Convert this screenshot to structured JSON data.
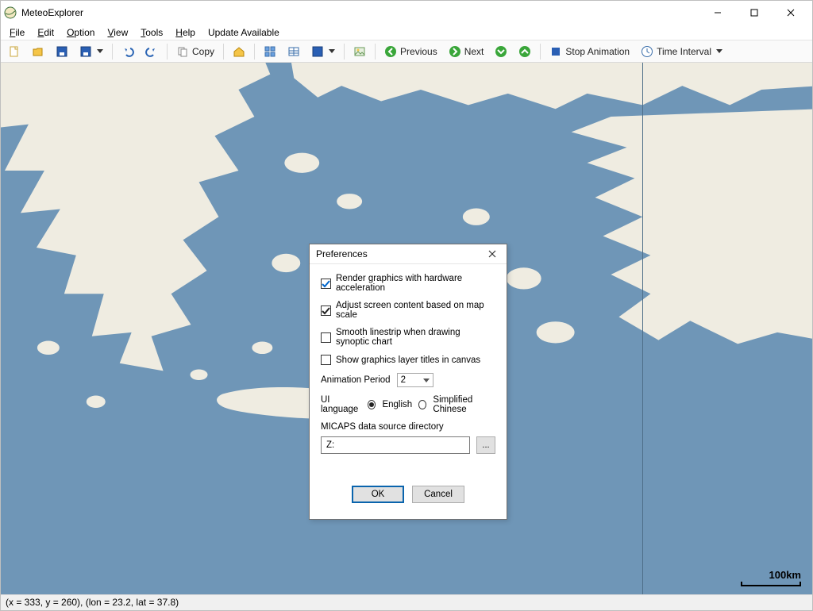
{
  "app": {
    "title": "MeteoExplorer"
  },
  "menus": {
    "file": "File",
    "edit": "Edit",
    "option": "Option",
    "view": "View",
    "tools": "Tools",
    "help": "Help",
    "update": "Update Available"
  },
  "toolbar": {
    "copy_label": "Copy",
    "previous_label": "Previous",
    "next_label": "Next",
    "stop_label": "Stop Animation",
    "time_interval_label": "Time Interval"
  },
  "map": {
    "scale_label": "100km"
  },
  "dialog": {
    "title": "Preferences",
    "opt_hw_accel": "Render graphics with hardware acceleration",
    "opt_adjust_scale": "Adjust screen content based on map scale",
    "opt_smooth": "Smooth linestrip when drawing synoptic chart",
    "opt_titles": "Show graphics layer titles in canvas",
    "anim_period_label": "Animation Period",
    "anim_period_value": "2",
    "lang_label": "UI language",
    "lang_en": "English",
    "lang_cn": "Simplified Chinese",
    "micaps_label": "MICAPS data source directory",
    "micaps_value": "Z:",
    "browse": "...",
    "ok": "OK",
    "cancel": "Cancel"
  },
  "status": {
    "text": "(x = 333, y = 260), (lon = 23.2, lat = 37.8)"
  }
}
